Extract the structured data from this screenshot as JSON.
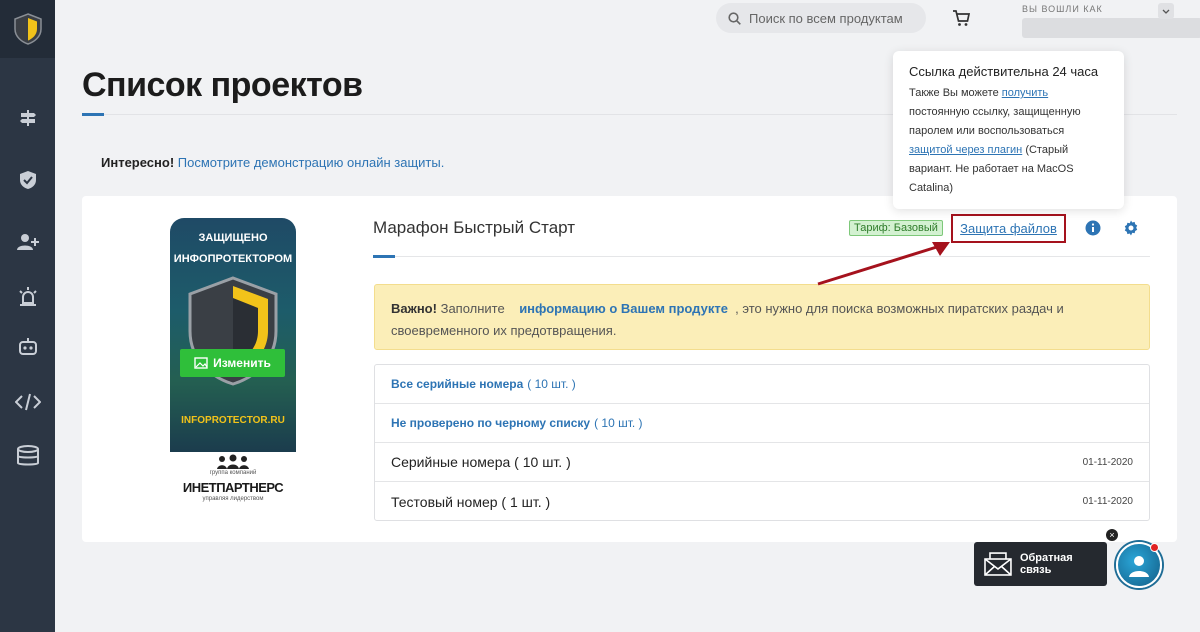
{
  "search": {
    "placeholder": "Поиск по всем продуктам"
  },
  "header": {
    "logged_in_label": "ВЫ ВОШЛИ КАК"
  },
  "page": {
    "title": "Списoк проектов"
  },
  "notice": {
    "bold": "Интересно!",
    "link": "Посмотрите демонстрацию онлайн защиты."
  },
  "project": {
    "name": "Марафон Быстрый Старт",
    "tariff": "Тариф: Базовый",
    "protect_files": "Защита файлов",
    "image": {
      "line1": "ЗАЩИЩЕНО",
      "line2": "ИНФОПРОТЕКТОРОМ",
      "site": "INFOPROTECTOR.RU",
      "change_label": "Изменить"
    },
    "partner": {
      "top": "группа компаний",
      "name": "ИНЕТПАРТНЕРС",
      "bottom": "управляя лидерством"
    }
  },
  "warning": {
    "bold": "Важно!",
    "pre": "Заполните",
    "link": "информацию о Вашем продукте",
    "post": ", это нужно для поиска возможных пиратских раздач и своевременного их предотвращения."
  },
  "serials": [
    {
      "label": "Все серийные номера",
      "count": "( 10 шт. )",
      "date": ""
    },
    {
      "label": "Не проверено по черному списку",
      "count": "( 10 шт. )",
      "date": ""
    },
    {
      "label": "Серийные номера ( 10 шт. )",
      "count": "",
      "date": "01-11-2020"
    },
    {
      "label": "Тестовый номер ( 1 шт. )",
      "count": "",
      "date": "01-11-2020"
    }
  ],
  "tooltip": {
    "heading": "Ссылка действительна 24 часа",
    "text1": "Также Вы можете",
    "link1": "получить",
    "text2": "постоянную ссылку, защищенную паролем или воспользоваться",
    "link2": "защитой через плагин",
    "text3": "(Старый вариант. Не работает на MacOS Catalina)"
  },
  "feedback": {
    "label": "Обратная связь",
    "close": "×"
  },
  "colors": {
    "accent": "#2d74b4",
    "sidebar": "#2c3644",
    "highlight_border": "#a5121d",
    "success": "#2fbf3a"
  }
}
